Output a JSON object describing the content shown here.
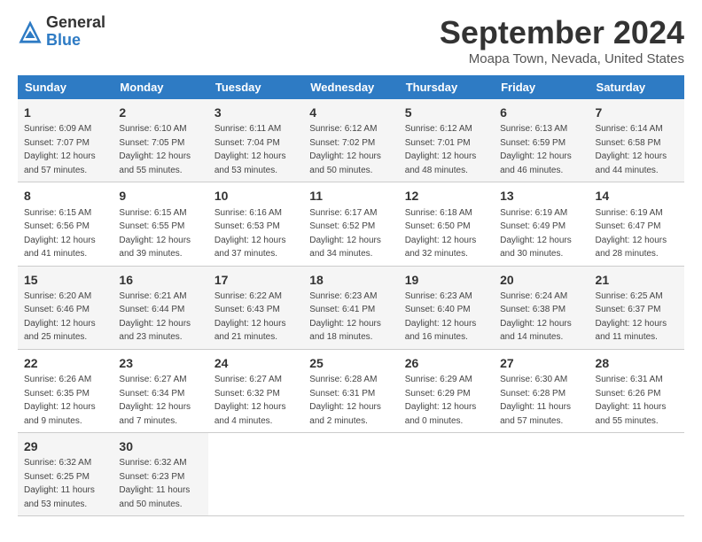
{
  "logo": {
    "general": "General",
    "blue": "Blue"
  },
  "title": "September 2024",
  "location": "Moapa Town, Nevada, United States",
  "days_header": [
    "Sunday",
    "Monday",
    "Tuesday",
    "Wednesday",
    "Thursday",
    "Friday",
    "Saturday"
  ],
  "weeks": [
    [
      {
        "day": "1",
        "info": "Sunrise: 6:09 AM\nSunset: 7:07 PM\nDaylight: 12 hours\nand 57 minutes."
      },
      {
        "day": "2",
        "info": "Sunrise: 6:10 AM\nSunset: 7:05 PM\nDaylight: 12 hours\nand 55 minutes."
      },
      {
        "day": "3",
        "info": "Sunrise: 6:11 AM\nSunset: 7:04 PM\nDaylight: 12 hours\nand 53 minutes."
      },
      {
        "day": "4",
        "info": "Sunrise: 6:12 AM\nSunset: 7:02 PM\nDaylight: 12 hours\nand 50 minutes."
      },
      {
        "day": "5",
        "info": "Sunrise: 6:12 AM\nSunset: 7:01 PM\nDaylight: 12 hours\nand 48 minutes."
      },
      {
        "day": "6",
        "info": "Sunrise: 6:13 AM\nSunset: 6:59 PM\nDaylight: 12 hours\nand 46 minutes."
      },
      {
        "day": "7",
        "info": "Sunrise: 6:14 AM\nSunset: 6:58 PM\nDaylight: 12 hours\nand 44 minutes."
      }
    ],
    [
      {
        "day": "8",
        "info": "Sunrise: 6:15 AM\nSunset: 6:56 PM\nDaylight: 12 hours\nand 41 minutes."
      },
      {
        "day": "9",
        "info": "Sunrise: 6:15 AM\nSunset: 6:55 PM\nDaylight: 12 hours\nand 39 minutes."
      },
      {
        "day": "10",
        "info": "Sunrise: 6:16 AM\nSunset: 6:53 PM\nDaylight: 12 hours\nand 37 minutes."
      },
      {
        "day": "11",
        "info": "Sunrise: 6:17 AM\nSunset: 6:52 PM\nDaylight: 12 hours\nand 34 minutes."
      },
      {
        "day": "12",
        "info": "Sunrise: 6:18 AM\nSunset: 6:50 PM\nDaylight: 12 hours\nand 32 minutes."
      },
      {
        "day": "13",
        "info": "Sunrise: 6:19 AM\nSunset: 6:49 PM\nDaylight: 12 hours\nand 30 minutes."
      },
      {
        "day": "14",
        "info": "Sunrise: 6:19 AM\nSunset: 6:47 PM\nDaylight: 12 hours\nand 28 minutes."
      }
    ],
    [
      {
        "day": "15",
        "info": "Sunrise: 6:20 AM\nSunset: 6:46 PM\nDaylight: 12 hours\nand 25 minutes."
      },
      {
        "day": "16",
        "info": "Sunrise: 6:21 AM\nSunset: 6:44 PM\nDaylight: 12 hours\nand 23 minutes."
      },
      {
        "day": "17",
        "info": "Sunrise: 6:22 AM\nSunset: 6:43 PM\nDaylight: 12 hours\nand 21 minutes."
      },
      {
        "day": "18",
        "info": "Sunrise: 6:23 AM\nSunset: 6:41 PM\nDaylight: 12 hours\nand 18 minutes."
      },
      {
        "day": "19",
        "info": "Sunrise: 6:23 AM\nSunset: 6:40 PM\nDaylight: 12 hours\nand 16 minutes."
      },
      {
        "day": "20",
        "info": "Sunrise: 6:24 AM\nSunset: 6:38 PM\nDaylight: 12 hours\nand 14 minutes."
      },
      {
        "day": "21",
        "info": "Sunrise: 6:25 AM\nSunset: 6:37 PM\nDaylight: 12 hours\nand 11 minutes."
      }
    ],
    [
      {
        "day": "22",
        "info": "Sunrise: 6:26 AM\nSunset: 6:35 PM\nDaylight: 12 hours\nand 9 minutes."
      },
      {
        "day": "23",
        "info": "Sunrise: 6:27 AM\nSunset: 6:34 PM\nDaylight: 12 hours\nand 7 minutes."
      },
      {
        "day": "24",
        "info": "Sunrise: 6:27 AM\nSunset: 6:32 PM\nDaylight: 12 hours\nand 4 minutes."
      },
      {
        "day": "25",
        "info": "Sunrise: 6:28 AM\nSunset: 6:31 PM\nDaylight: 12 hours\nand 2 minutes."
      },
      {
        "day": "26",
        "info": "Sunrise: 6:29 AM\nSunset: 6:29 PM\nDaylight: 12 hours\nand 0 minutes."
      },
      {
        "day": "27",
        "info": "Sunrise: 6:30 AM\nSunset: 6:28 PM\nDaylight: 11 hours\nand 57 minutes."
      },
      {
        "day": "28",
        "info": "Sunrise: 6:31 AM\nSunset: 6:26 PM\nDaylight: 11 hours\nand 55 minutes."
      }
    ],
    [
      {
        "day": "29",
        "info": "Sunrise: 6:32 AM\nSunset: 6:25 PM\nDaylight: 11 hours\nand 53 minutes."
      },
      {
        "day": "30",
        "info": "Sunrise: 6:32 AM\nSunset: 6:23 PM\nDaylight: 11 hours\nand 50 minutes."
      },
      {
        "day": "",
        "info": ""
      },
      {
        "day": "",
        "info": ""
      },
      {
        "day": "",
        "info": ""
      },
      {
        "day": "",
        "info": ""
      },
      {
        "day": "",
        "info": ""
      }
    ]
  ]
}
